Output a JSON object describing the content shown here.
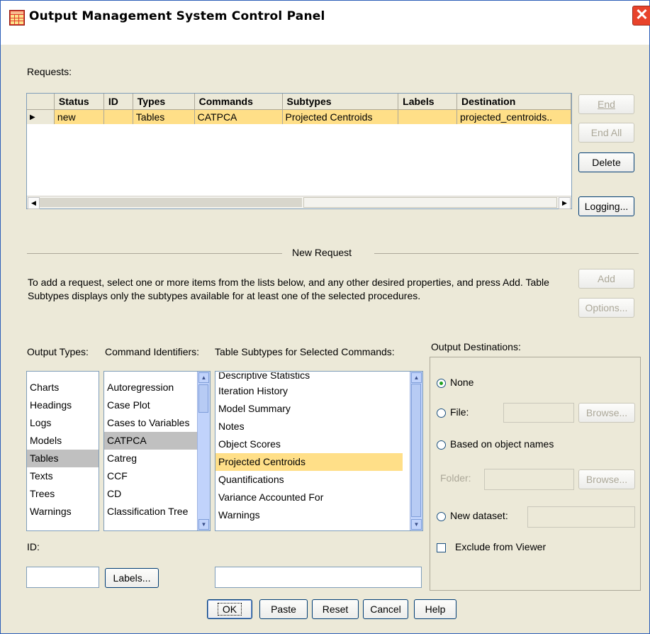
{
  "window": {
    "title": "Output Management System Control Panel",
    "close_glyph": "✕",
    "app_icon": "table-grid-icon"
  },
  "requests": {
    "label": "Requests:",
    "columns": [
      "Status",
      "ID",
      "Types",
      "Commands",
      "Subtypes",
      "Labels",
      "Destination"
    ],
    "rows": [
      {
        "status": "new",
        "id": "",
        "types": "Tables",
        "commands": "CATPCA",
        "subtypes": "Projected Centroids",
        "labels": "",
        "destination": "projected_centroids.."
      }
    ],
    "row_marker": "▶",
    "buttons": {
      "end": "End",
      "end_all": "End All",
      "delete": "Delete",
      "logging": "Logging..."
    }
  },
  "new_request": {
    "heading": "New Request",
    "instructions": "To add a request, select one or more items from the lists below, and any other desired properties, and press Add. Table Subtypes displays only the subtypes available for at least one of the selected procedures.",
    "add_label": "Add",
    "options_label": "Options..."
  },
  "output_types": {
    "label": "Output Types:",
    "items": [
      "Charts",
      "Headings",
      "Logs",
      "Models",
      "Tables",
      "Texts",
      "Trees",
      "Warnings"
    ],
    "selected": "Tables"
  },
  "command_identifiers": {
    "label": "Command Identifiers:",
    "items": [
      "Autoregression",
      "Case Plot",
      "Cases to Variables",
      "CATPCA",
      "Catreg",
      "CCF",
      "CD",
      "Classification Tree"
    ],
    "selected": "CATPCA"
  },
  "table_subtypes": {
    "label": "Table Subtypes for Selected Commands:",
    "items": [
      "Descriptive Statistics",
      "Iteration History",
      "Model Summary",
      "Notes",
      "Object Scores",
      "Projected Centroids",
      "Quantifications",
      "Variance Accounted For",
      "Warnings"
    ],
    "selected": "Projected Centroids"
  },
  "destinations": {
    "label": "Output Destinations:",
    "none": "None",
    "file": "File:",
    "browse": "Browse...",
    "based_on_names": "Based on object names",
    "folder": "Folder:",
    "new_dataset": "New dataset:",
    "exclude": "Exclude from Viewer",
    "selected": "None"
  },
  "id_field": {
    "label": "ID:",
    "value": ""
  },
  "labels_button": "Labels...",
  "footer": {
    "ok": "OK",
    "paste": "Paste",
    "reset": "Reset",
    "cancel": "Cancel",
    "help": "Help"
  }
}
